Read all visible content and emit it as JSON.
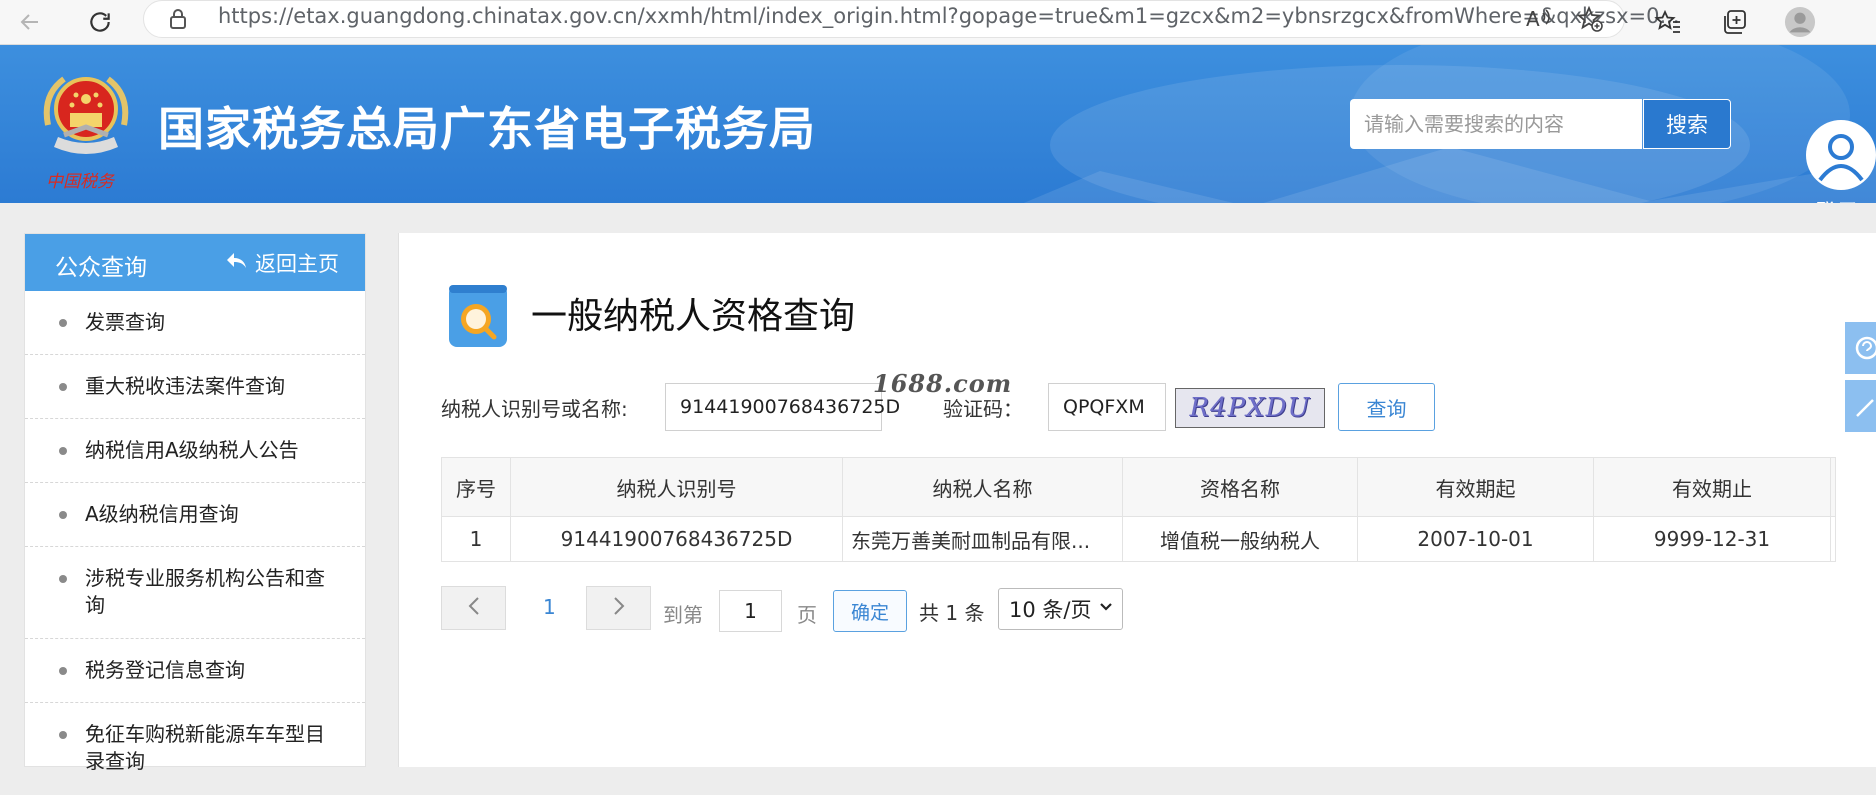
{
  "browser": {
    "url": "https://etax.guangdong.chinatax.gov.cn/xxmh/html/index_origin.html?gopage=true&m1=gzcx&m2=ybnsrzgcx&fromWhere=&qxkzsx=0...",
    "icons": [
      "back-arrow-icon",
      "reload-icon",
      "lock-icon",
      "read-aloud-icon",
      "favorite-add-icon",
      "favorites-icon",
      "collections-icon",
      "profile-icon"
    ]
  },
  "header": {
    "emblem_caption": "中国税务",
    "title": "国家税务总局广东省电子税务局",
    "search_placeholder": "请输入需要搜索的内容",
    "search_button": "搜索",
    "login_label": "登录"
  },
  "sidebar": {
    "title": "公众查询",
    "back_label": "返回主页",
    "items": [
      {
        "label": "发票查询"
      },
      {
        "label": "重大税收违法案件查询"
      },
      {
        "label": "纳税信用A级纳税人公告"
      },
      {
        "label": "A级纳税信用查询"
      },
      {
        "label": "涉税专业服务机构公告和查询"
      },
      {
        "label": "税务登记信息查询"
      },
      {
        "label": "免征车购税新能源车车型目录查询"
      }
    ]
  },
  "main": {
    "title": "一般纳税人资格查询",
    "query_label": "纳税人识别号或名称:",
    "query_value": "91441900768436725D",
    "captcha_label": "验证码：",
    "captcha_value": "QPQFXM",
    "captcha_image_text": "R4PXDU",
    "query_button": "查询",
    "watermark": "1688.com"
  },
  "table": {
    "headers": [
      "序号",
      "纳税人识别号",
      "纳税人名称",
      "资格名称",
      "有效期起",
      "有效期止"
    ],
    "rows": [
      [
        "1",
        "91441900768436725D",
        "东莞万善美耐皿制品有限...",
        "增值税一般纳税人",
        "2007-10-01",
        "9999-12-31"
      ]
    ]
  },
  "pagination": {
    "current_page": "1",
    "goto_label": "到第",
    "goto_value": "1",
    "page_unit": "页",
    "confirm": "确定",
    "total": "共 1 条",
    "page_size": "10 条/页"
  },
  "colors": {
    "header_blue": "#2c7bd3",
    "sidebar_head": "#4a9fe6",
    "link_blue": "#3a86d3"
  }
}
